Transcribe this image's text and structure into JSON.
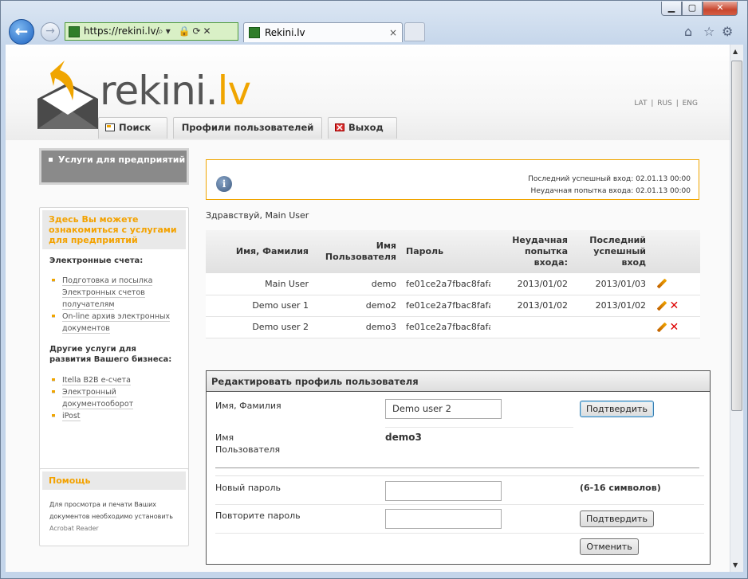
{
  "browser": {
    "url": "https://rekini.lv/",
    "tab_title": "Rekini.lv",
    "tab_close": "×"
  },
  "header": {
    "logo_main": "rekini.",
    "logo_accent": "lv",
    "languages": [
      "LAT",
      "RUS",
      "ENG"
    ],
    "nav": {
      "search": "Поиск",
      "profiles": "Профили пользователей",
      "exit": "Выход"
    }
  },
  "sidebar": {
    "active_item": "Услуги для предприятий",
    "box1": {
      "title": "Здесь Вы можете ознакомиться с услугами для предприятий",
      "section1": "Электронные счета:",
      "links1": [
        "Подготовка и посылка Электронных счетов получателям",
        "On-line архив электронных документов"
      ],
      "section2": "Другие услуги для развития Вашего бизнеса:",
      "links2": [
        "Itella B2B e-счета",
        "Электронный документооборот",
        "iPost"
      ]
    },
    "help": {
      "title": "Помощь",
      "text": "Для просмотра и печати Ваших документов необходимо установить",
      "link": "Acrobat Reader"
    }
  },
  "info": {
    "last_success": "Последний успешный вход: 02.01.13 00:00",
    "last_failed": "Неудачная попытка входа: 02.01.13 00:00"
  },
  "greeting": "Здравствуй, Main User",
  "users_table": {
    "headers": [
      "Имя, Фамилия",
      "Имя Пользователя",
      "Пароль",
      "Неудачная попытка входа:",
      "Последний успешный вход"
    ],
    "rows": [
      {
        "name": "Main User",
        "username": "demo",
        "password": "fe01ce2a7fbac8fafa",
        "failed": "2013/01/02",
        "last": "2013/01/03",
        "deletable": false
      },
      {
        "name": "Demo user 1",
        "username": "demo2",
        "password": "fe01ce2a7fbac8fafa",
        "failed": "2013/01/02",
        "last": "2013/01/02",
        "deletable": true
      },
      {
        "name": "Demo user 2",
        "username": "demo3",
        "password": "fe01ce2a7fbac8fafa",
        "failed": "",
        "last": "",
        "deletable": true
      }
    ]
  },
  "edit_profile": {
    "title": "Редактировать профиль пользователя",
    "name_label": "Имя, Фамилия",
    "name_value": "Demo user 2",
    "confirm_label": "Подтвердить",
    "username_label": "Имя Пользователя",
    "username_value": "demo3",
    "new_password_label": "Новый пароль",
    "password_hint": "(6-16 символов)",
    "repeat_password_label": "Повторите пароль",
    "confirm2_label": "Подтвердить",
    "cancel_label": "Отменить"
  },
  "colors": {
    "accent": "#f0a500",
    "delete": "#dd0000",
    "secure_green": "#d9f0c6"
  }
}
